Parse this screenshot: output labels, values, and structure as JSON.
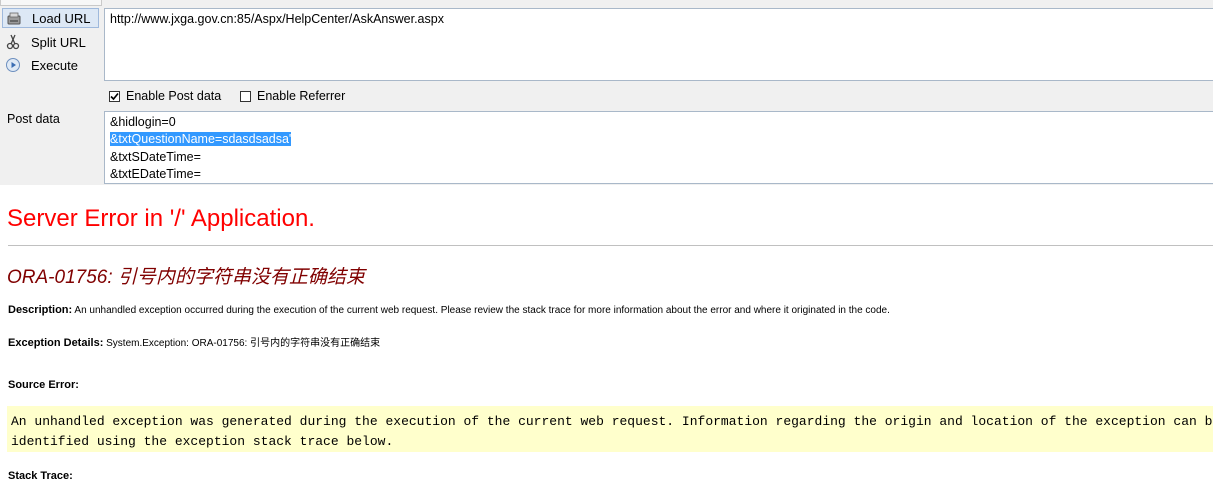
{
  "toolbar": {
    "load_url": "Load URL",
    "split_url": "Split URL",
    "execute": "Execute"
  },
  "url": "http://www.jxga.gov.cn:85/Aspx/HelpCenter/AskAnswer.aspx",
  "options": {
    "enable_post_data": "Enable Post data",
    "enable_post_data_checked": true,
    "enable_referrer": "Enable Referrer",
    "enable_referrer_checked": false
  },
  "post": {
    "label": "Post data",
    "lines": [
      "&hidlogin=0",
      "&txtQuestionName=sdasdsadsa'",
      "&txtSDateTime=",
      "&txtEDateTime="
    ],
    "selected_line": 1
  },
  "page": {
    "title": "Server Error in '/' Application.",
    "error_heading": "ORA-01756: 引号内的字符串没有正确结束",
    "description_label": "Description:",
    "description_text": "An unhandled exception occurred during the execution of the current web request. Please review the stack trace for more information about the error and where it originated in the code.",
    "exception_label": "Exception Details:",
    "exception_text": "System.Exception: ORA-01756: 引号内的字符串没有正确结束",
    "source_error_label": "Source Error:",
    "source_error_line1": "An unhandled exception was generated during the execution of the current web request. Information regarding the origin and location of the exception can be",
    "source_error_line2": "identified using the exception stack trace below.",
    "stack_trace_label": "Stack Trace:"
  },
  "colors": {
    "title": "#ff0000",
    "heading": "#800000",
    "code_background": "#ffffcc",
    "selection": "#3399ff"
  }
}
